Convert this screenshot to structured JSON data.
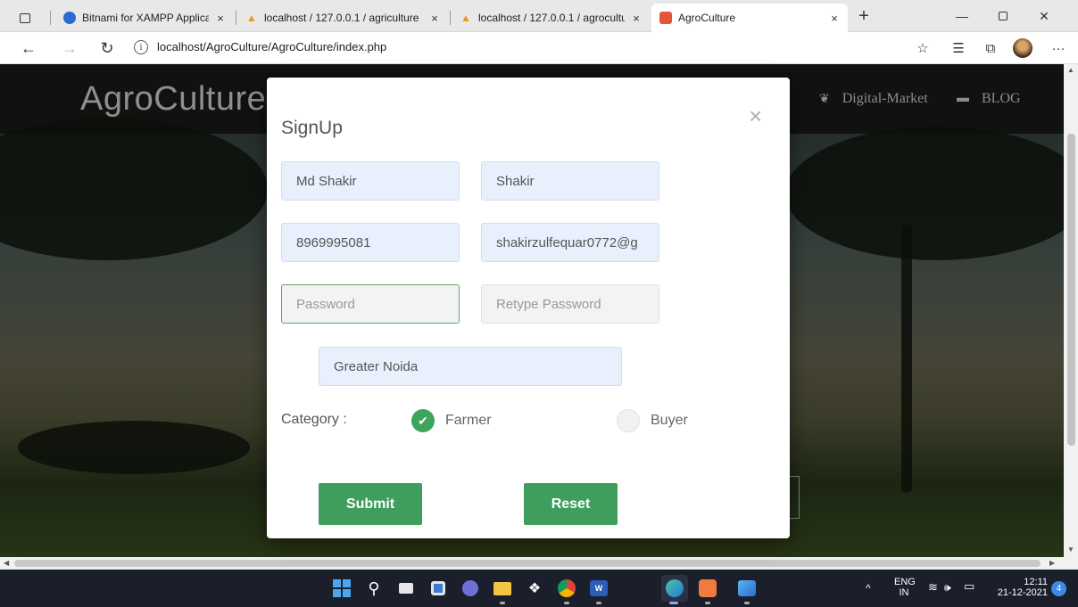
{
  "browser": {
    "tabs": [
      {
        "label": "Bitnami for XAMPP Application N",
        "active": false
      },
      {
        "label": "localhost / 127.0.0.1 / agriculture",
        "active": false
      },
      {
        "label": "localhost / 127.0.0.1 / agrocultur",
        "active": false
      },
      {
        "label": "AgroCulture",
        "active": true
      }
    ],
    "tab_close": "×",
    "new_tab": "+",
    "url": "localhost/AgroCulture/AgroCulture/index.php"
  },
  "site": {
    "brand": "AgroCulture",
    "nav": [
      {
        "label": "Digital-Market",
        "icon": "plant-icon"
      },
      {
        "label": "BLOG",
        "icon": "comment-icon"
      }
    ]
  },
  "signup": {
    "title": "SignUp",
    "close": "×",
    "name_value": "Md Shakir",
    "username_value": "Shakir",
    "mobile_value": "8969995081",
    "email_value": "shakirzulfequar0772@g",
    "password_placeholder": "Password",
    "retype_placeholder": "Retype Password",
    "address_value": "Greater Noida",
    "category_label": "Category :",
    "categories": [
      {
        "label": "Farmer",
        "selected": true
      },
      {
        "label": "Buyer",
        "selected": false
      }
    ],
    "submit_label": "Submit",
    "reset_label": "Reset"
  },
  "taskbar": {
    "language": "ENG",
    "region": "IN",
    "time": "12:11",
    "date": "21-12-2021",
    "notification_count": "4"
  },
  "colors": {
    "accent_green": "#3f9e5e",
    "autofill_blue": "#e8f0fe",
    "taskbar": "#1b1f2b"
  }
}
